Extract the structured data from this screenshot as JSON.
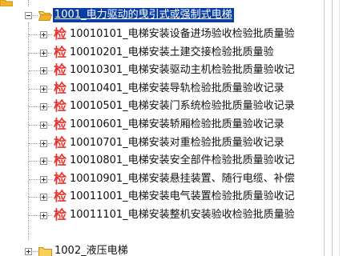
{
  "tree": {
    "top_node": {
      "label": "1001_电力驱动的曳引式或强制式电梯"
    },
    "children": [
      {
        "icon_text": "检",
        "label": "10010101_电梯安装设备进场验收检验批质量验"
      },
      {
        "icon_text": "检",
        "label": "10010201_电梯安装土建交接检验批质量验"
      },
      {
        "icon_text": "检",
        "label": "10010301_电梯安装驱动主机检验批质量验收记"
      },
      {
        "icon_text": "检",
        "label": "10010401_电梯安装导轨检验批质量验收记录"
      },
      {
        "icon_text": "检",
        "label": "10010501_电梯安装门系统检验批质量验收记录"
      },
      {
        "icon_text": "检",
        "label": "10010601_电梯安装轿厢检验批质量验收记录"
      },
      {
        "icon_text": "检",
        "label": "10010701_电梯安装对重检验批质量验收记录"
      },
      {
        "icon_text": "检",
        "label": "10010801_电梯安装安全部件检验批质量验收记"
      },
      {
        "icon_text": "检",
        "label": "10010901_电梯安装悬挂装置、随行电缆、补偿"
      },
      {
        "icon_text": "检",
        "label": "10011001_电梯安装电气装置检验批质量验收记"
      },
      {
        "icon_text": "检",
        "label": "10011101_电梯安装整机安装验收检验批质量验"
      }
    ],
    "next_node": {
      "label": "1002_液压电梯"
    }
  },
  "colors": {
    "selection_bg": "#0a3ea3",
    "check_icon": "#e8322c",
    "folder": "#f0c040"
  }
}
